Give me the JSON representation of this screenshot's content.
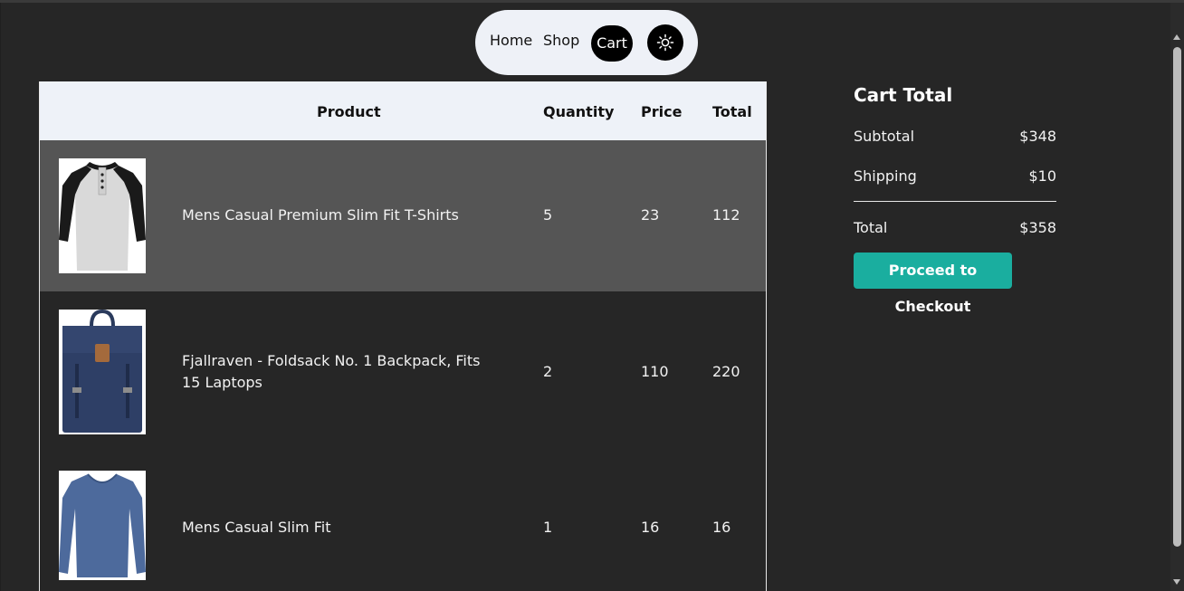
{
  "nav": {
    "home": "Home",
    "shop": "Shop",
    "cart": "Cart",
    "theme_icon": "sun-icon"
  },
  "table": {
    "headers": [
      "Product",
      "Quantity",
      "Price",
      "Total"
    ],
    "rows": [
      {
        "name": "Mens Casual Premium Slim Fit T-Shirts",
        "quantity": "5",
        "price": "23",
        "total": "112",
        "image": "raglan-henley-shirt"
      },
      {
        "name": "Fjallraven - Foldsack No. 1 Backpack, Fits 15 Laptops",
        "quantity": "2",
        "price": "110",
        "total": "220",
        "image": "navy-backpack"
      },
      {
        "name": "Mens Casual Slim Fit",
        "quantity": "1",
        "price": "16",
        "total": "16",
        "image": "blue-long-sleeve-shirt"
      }
    ]
  },
  "summary": {
    "title": "Cart Total",
    "subtotal_label": "Subtotal",
    "subtotal_value": "$348",
    "shipping_label": "Shipping",
    "shipping_value": "$10",
    "total_label": "Total",
    "total_value": "$358",
    "checkout_label": "Proceed to Checkout"
  },
  "colors": {
    "background": "#262626",
    "highlight_row": "#555555",
    "checkout_button": "#1aae9f",
    "nav_pill": "#eef1f7"
  }
}
